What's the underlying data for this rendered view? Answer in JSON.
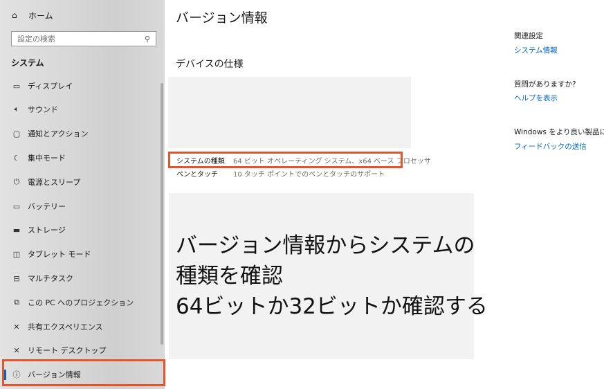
{
  "sidebar": {
    "home_label": "ホーム",
    "search_placeholder": "設定の検索",
    "section_title": "システム",
    "items": [
      {
        "label": "ディスプレイ",
        "icon": "display-icon"
      },
      {
        "label": "サウンド",
        "icon": "speaker-icon"
      },
      {
        "label": "通知とアクション",
        "icon": "notification-icon"
      },
      {
        "label": "集中モード",
        "icon": "moon-icon"
      },
      {
        "label": "電源とスリープ",
        "icon": "power-icon"
      },
      {
        "label": "バッテリー",
        "icon": "battery-icon"
      },
      {
        "label": "ストレージ",
        "icon": "storage-icon"
      },
      {
        "label": "タブレット モード",
        "icon": "tablet-icon"
      },
      {
        "label": "マルチタスク",
        "icon": "multitask-icon"
      },
      {
        "label": "この PC へのプロジェクション",
        "icon": "projection-icon"
      },
      {
        "label": "共有エクスペリエンス",
        "icon": "share-icon"
      },
      {
        "label": "リモート デスクトップ",
        "icon": "remote-icon"
      },
      {
        "label": "バージョン情報",
        "icon": "info-icon",
        "selected": true
      }
    ]
  },
  "main": {
    "title": "バージョン情報",
    "subtitle": "デバイスの仕様",
    "specs": [
      {
        "key": "システムの種類",
        "value": "64 ビット オペレーティング システム、x64 ベース プロセッサ"
      },
      {
        "key": "ペンとタッチ",
        "value": "10 タッチ ポイントでのペンとタッチのサポート"
      }
    ]
  },
  "callout": {
    "lines": [
      "バージョン情報からシステムの",
      "種類を確認",
      "64ビットか32ビットか確認する"
    ]
  },
  "right_panel": {
    "related_heading": "関連設定",
    "related_link": "システム情報",
    "question_heading": "質問がありますか?",
    "help_link": "ヘルプを表示",
    "windows_heading": "Windows をより良い製品に",
    "feedback_link": "フィードバックの送信"
  },
  "colors": {
    "accent": "#0067c0",
    "highlight_border": "#e8542a"
  }
}
